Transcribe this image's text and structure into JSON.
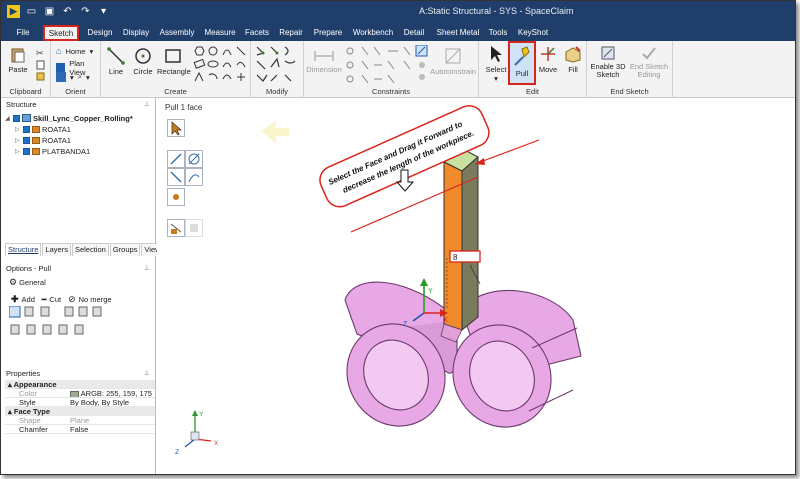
{
  "window": {
    "title": "A:Static Structural - SYS - SpaceClaim"
  },
  "ribbon": {
    "tabs": [
      "File",
      "Sketch",
      "Design",
      "Display",
      "Assembly",
      "Measure",
      "Facets",
      "Repair",
      "Prepare",
      "Workbench",
      "Detail",
      "Sheet Metal",
      "Tools",
      "KeyShot"
    ],
    "active_tab": "Sketch",
    "clipboard": {
      "label": "Clipboard",
      "paste": "Paste"
    },
    "orient": {
      "label": "Orient",
      "home": "Home",
      "plan_view": "Plan View"
    },
    "create": {
      "label": "Create",
      "line": "Line",
      "circle": "Circle",
      "rectangle": "Rectangle"
    },
    "modify": {
      "label": "Modify"
    },
    "constraints": {
      "label": "Constraints",
      "dimension": "Dimension",
      "autoconstrain": "Autoconstrain"
    },
    "edit": {
      "label": "Edit",
      "select": "Select",
      "pull": "Pull",
      "move": "Move",
      "fill": "Fill"
    },
    "end_sketch": {
      "label": "End Sketch",
      "enable3d": "Enable 3D Sketch",
      "end_editing": "End Sketch Editing"
    }
  },
  "structure": {
    "title": "Structure",
    "root": "Skill_Lync_Copper_Rolling*",
    "children": [
      "ROATA1",
      "ROATA1",
      "PLATBANDA1"
    ]
  },
  "panel_tabs": [
    "Structure",
    "Layers",
    "Selection",
    "Groups",
    "Views"
  ],
  "options": {
    "title": "Options - Pull",
    "general": "General",
    "add": "Add",
    "cut": "Cut",
    "no_merge": "No merge"
  },
  "properties": {
    "title": "Properties",
    "sections": [
      {
        "name": "Appearance",
        "rows": [
          {
            "key": "Color",
            "value": "ARGB: 255, 159, 175"
          },
          {
            "key": "Style",
            "value": "By Body, By Style"
          }
        ]
      },
      {
        "name": "Face Type",
        "rows": [
          {
            "key": "Shape",
            "value": "Plane"
          },
          {
            "key": "Chamfer",
            "value": "False"
          }
        ]
      }
    ]
  },
  "viewport": {
    "mode_label": "Pull 1 face",
    "annotation": "Select the Face and Drag it Forward to decrease the length of the workpiece.",
    "dimension_value": "8",
    "axis_labels": {
      "x": "X",
      "y": "Y",
      "z": "Z"
    }
  },
  "colors": {
    "title_bar": "#1f3f6a",
    "highlight_red": "#d9241b",
    "plate_orange": "#f08a2a",
    "face_green": "#c8e0a0",
    "roller_pink": "#e8a8e6",
    "color_swatch": "#9fad8f"
  }
}
